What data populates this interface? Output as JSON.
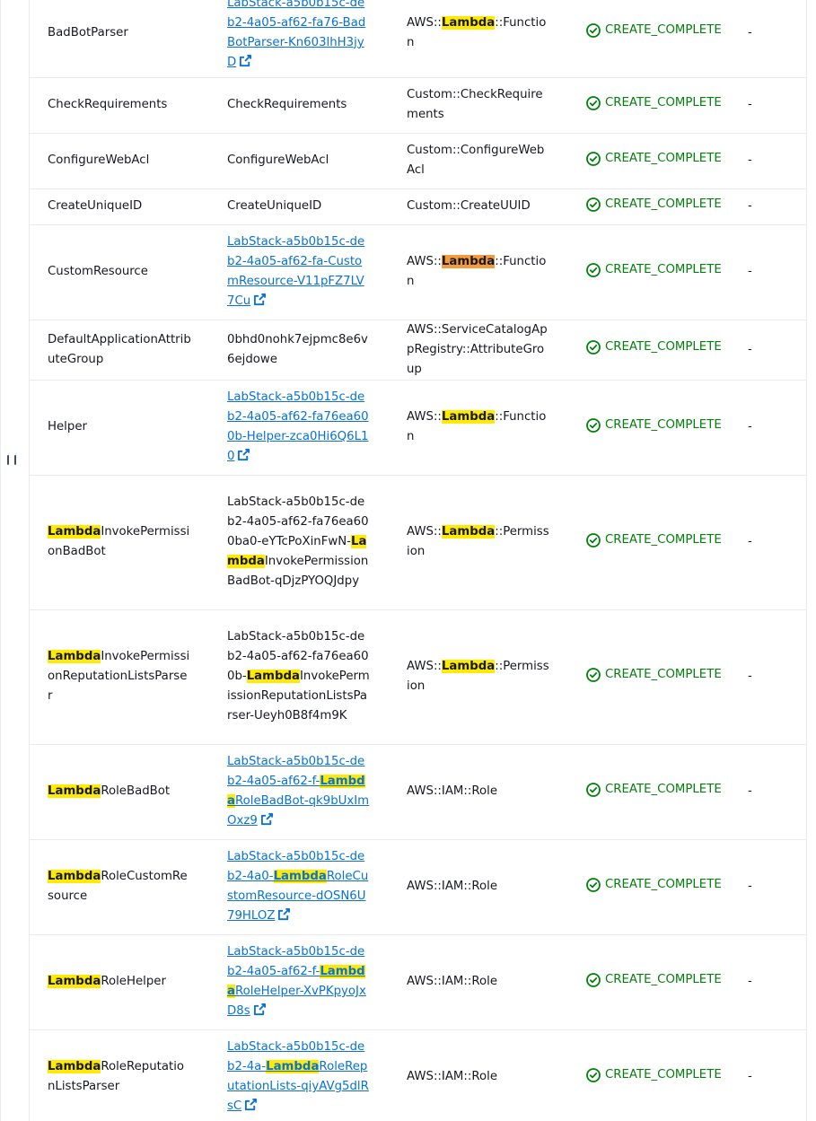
{
  "rows": [
    {
      "logical": [
        {
          "t": "BadBotParser"
        }
      ],
      "physical_link": true,
      "physical": [
        {
          "t": "LabStack-a5b0b15c-deb2-4a05-af62-fa76-BadBotParser-Kn603lhH3jyD"
        }
      ],
      "type": [
        {
          "t": "AWS::"
        },
        {
          "t": "Lambda",
          "h": "hl"
        },
        {
          "t": "::Function"
        }
      ],
      "status": "CREATE_COMPLETE",
      "reason": "-"
    },
    {
      "logical": [
        {
          "t": "CheckRequirements"
        }
      ],
      "physical_link": false,
      "physical": [
        {
          "t": "CheckRequirements"
        }
      ],
      "type": [
        {
          "t": "Custom::CheckRequirements"
        }
      ],
      "status": "CREATE_COMPLETE",
      "reason": "-"
    },
    {
      "logical": [
        {
          "t": "ConfigureWebAcl"
        }
      ],
      "physical_link": false,
      "physical": [
        {
          "t": "ConfigureWebAcl"
        }
      ],
      "type": [
        {
          "t": "Custom::ConfigureWebAcl"
        }
      ],
      "status": "CREATE_COMPLETE",
      "reason": "-"
    },
    {
      "logical": [
        {
          "t": "CreateUniqueID"
        }
      ],
      "physical_link": false,
      "physical": [
        {
          "t": "CreateUniqueID"
        }
      ],
      "type": [
        {
          "t": "Custom::CreateUUID"
        }
      ],
      "status": "CREATE_COMPLETE",
      "reason": "-"
    },
    {
      "logical": [
        {
          "t": "CustomResource"
        }
      ],
      "physical_link": true,
      "physical": [
        {
          "t": "LabStack-a5b0b15c-deb2-4a05-af62-fa-CustomResource-V11pFZ7LV7Cu"
        }
      ],
      "type": [
        {
          "t": "AWS::"
        },
        {
          "t": "Lambda",
          "h": "hl-cur"
        },
        {
          "t": "::Function"
        }
      ],
      "status": "CREATE_COMPLETE",
      "reason": "-"
    },
    {
      "logical": [
        {
          "t": "DefaultApplicationAttributeGroup"
        }
      ],
      "physical_link": false,
      "physical": [
        {
          "t": "0bhd0nohk7ejpmc8e6v6ejdowe"
        }
      ],
      "type": [
        {
          "t": "AWS::ServiceCatalogAppRegistry::AttributeGroup"
        }
      ],
      "status": "CREATE_COMPLETE",
      "reason": "-"
    },
    {
      "logical": [
        {
          "t": "Helper"
        }
      ],
      "physical_link": true,
      "physical": [
        {
          "t": "LabStack-a5b0b15c-deb2-4a05-af62-fa76ea600b-Helper-zca0Hi6Q6L10"
        }
      ],
      "type": [
        {
          "t": "AWS::"
        },
        {
          "t": "Lambda",
          "h": "hl"
        },
        {
          "t": "::Function"
        }
      ],
      "status": "CREATE_COMPLETE",
      "reason": "-"
    },
    {
      "logical": [
        {
          "t": "Lambda",
          "h": "hl"
        },
        {
          "t": "InvokePermissionBadBot"
        }
      ],
      "physical_link": false,
      "physical": [
        {
          "t": "LabStack-a5b0b15c-deb2-4a05-af62-fa76ea600ba0-eYTcPoXinFwN-"
        },
        {
          "t": "Lambda",
          "h": "hl"
        },
        {
          "t": "InvokePermissionBadBot-qDjzPYOQJdpy"
        }
      ],
      "type": [
        {
          "t": "AWS::"
        },
        {
          "t": "Lambda",
          "h": "hl"
        },
        {
          "t": "::Permission"
        }
      ],
      "status": "CREATE_COMPLETE",
      "reason": "-"
    },
    {
      "logical": [
        {
          "t": "Lambda",
          "h": "hl"
        },
        {
          "t": "InvokePermissionReputationListsParser"
        }
      ],
      "physical_link": false,
      "physical": [
        {
          "t": "LabStack-a5b0b15c-deb2-4a05-af62-fa76ea600b-"
        },
        {
          "t": "Lambda",
          "h": "hl"
        },
        {
          "t": "InvokePermissionReputationListsParser-Ueyh0B8f4m9K"
        }
      ],
      "type": [
        {
          "t": "AWS::"
        },
        {
          "t": "Lambda",
          "h": "hl"
        },
        {
          "t": "::Permission"
        }
      ],
      "status": "CREATE_COMPLETE",
      "reason": "-"
    },
    {
      "logical": [
        {
          "t": "Lambda",
          "h": "hl"
        },
        {
          "t": "RoleBadBot"
        }
      ],
      "physical_link": true,
      "physical": [
        {
          "t": "LabStack-a5b0b15c-deb2-4a05-af62-f-"
        },
        {
          "t": "Lambda",
          "h": "hl"
        },
        {
          "t": "RoleBadBot-qk9bUxImOxz9"
        }
      ],
      "type": [
        {
          "t": "AWS::IAM::Role"
        }
      ],
      "status": "CREATE_COMPLETE",
      "reason": "-"
    },
    {
      "logical": [
        {
          "t": "Lambda",
          "h": "hl"
        },
        {
          "t": "RoleCustomResource"
        }
      ],
      "physical_link": true,
      "physical": [
        {
          "t": "LabStack-a5b0b15c-deb2-4a0-"
        },
        {
          "t": "Lambda",
          "h": "hl"
        },
        {
          "t": "RoleCustomResource-dOSN6U79HLOZ"
        }
      ],
      "type": [
        {
          "t": "AWS::IAM::Role"
        }
      ],
      "status": "CREATE_COMPLETE",
      "reason": "-"
    },
    {
      "logical": [
        {
          "t": "Lambda",
          "h": "hl"
        },
        {
          "t": "RoleHelper"
        }
      ],
      "physical_link": true,
      "physical": [
        {
          "t": "LabStack-a5b0b15c-deb2-4a05-af62-f-"
        },
        {
          "t": "Lambda",
          "h": "hl"
        },
        {
          "t": "RoleHelper-XvPKpyoJxD8s"
        }
      ],
      "type": [
        {
          "t": "AWS::IAM::Role"
        }
      ],
      "status": "CREATE_COMPLETE",
      "reason": "-"
    },
    {
      "logical": [
        {
          "t": "Lambda",
          "h": "hl"
        },
        {
          "t": "RoleReputationListsParser"
        }
      ],
      "physical_link": true,
      "physical": [
        {
          "t": "LabStack-a5b0b15c-deb2-4a-"
        },
        {
          "t": "Lambda",
          "h": "hl"
        },
        {
          "t": "RoleReputationLists-qiyAVg5dlRsC"
        }
      ],
      "type": [
        {
          "t": "AWS::IAM::Role"
        }
      ],
      "status": "CREATE_COMPLETE",
      "reason": "-"
    }
  ],
  "icons": {
    "external_link": "external-link-icon",
    "status_success": "status-success-icon",
    "resize_handle": "resize-handle-icon"
  },
  "colors": {
    "link": "#0972d3",
    "success": "#037f0c",
    "search_highlight": "#ffea00",
    "current_match_highlight": "#f49b3b",
    "divider": "#e9ebed"
  }
}
